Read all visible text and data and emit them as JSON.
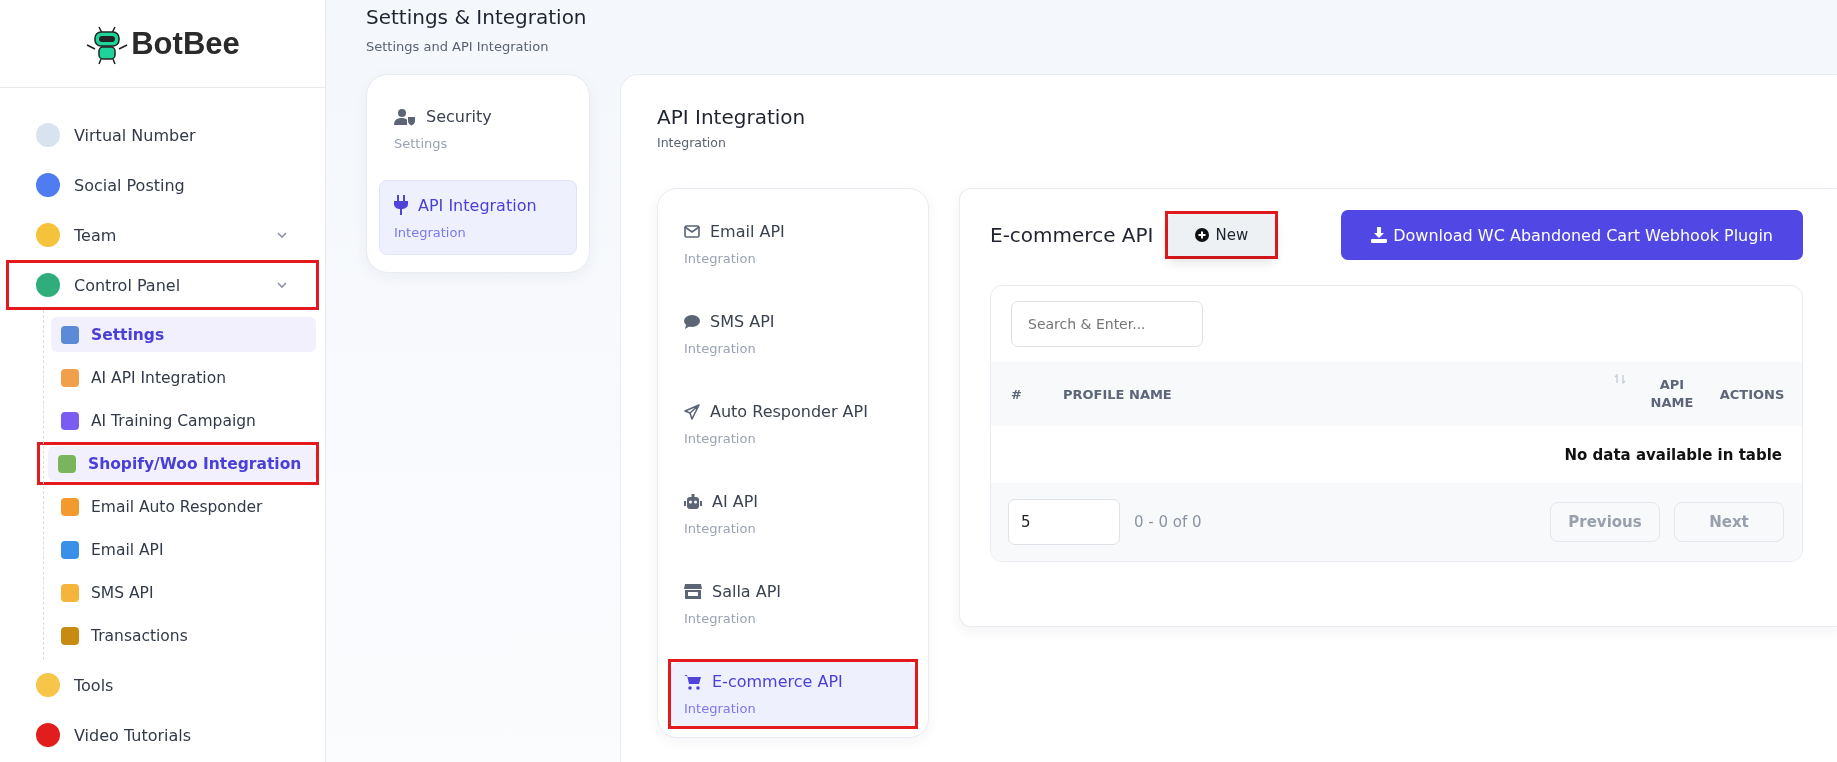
{
  "brand": {
    "name": "BotBee"
  },
  "sidebar": {
    "items": [
      {
        "label": "Virtual Number",
        "expandable": false,
        "highlighted": false
      },
      {
        "label": "Social Posting",
        "expandable": false,
        "highlighted": false
      },
      {
        "label": "Team",
        "expandable": true,
        "highlighted": false
      },
      {
        "label": "Control Panel",
        "expandable": true,
        "highlighted": true,
        "expanded": true,
        "children": [
          {
            "label": "Settings",
            "selected": true,
            "highlighted": false
          },
          {
            "label": "AI API Integration",
            "selected": false,
            "highlighted": false
          },
          {
            "label": "AI Training Campaign",
            "selected": false,
            "highlighted": false
          },
          {
            "label": "Shopify/Woo Integration",
            "selected": true,
            "highlighted": true
          },
          {
            "label": "Email Auto Responder",
            "selected": false,
            "highlighted": false
          },
          {
            "label": "Email API",
            "selected": false,
            "highlighted": false
          },
          {
            "label": "SMS API",
            "selected": false,
            "highlighted": false
          },
          {
            "label": "Transactions",
            "selected": false,
            "highlighted": false
          }
        ]
      },
      {
        "label": "Tools",
        "expandable": false,
        "highlighted": false
      },
      {
        "label": "Video Tutorials",
        "expandable": false,
        "highlighted": false
      }
    ]
  },
  "page": {
    "title": "Settings & Integration",
    "subtitle": "Settings and API Integration"
  },
  "settings_menu": [
    {
      "label": "Security",
      "sub": "Settings",
      "selected": false
    },
    {
      "label": "API Integration",
      "sub": "Integration",
      "selected": true
    }
  ],
  "api_panel": {
    "title": "API Integration",
    "subtitle": "Integration",
    "tabs": [
      {
        "label": "Email API",
        "sub": "Integration",
        "selected": false,
        "highlighted": false
      },
      {
        "label": "SMS API",
        "sub": "Integration",
        "selected": false,
        "highlighted": false
      },
      {
        "label": "Auto Responder API",
        "sub": "Integration",
        "selected": false,
        "highlighted": false
      },
      {
        "label": "AI API",
        "sub": "Integration",
        "selected": false,
        "highlighted": false
      },
      {
        "label": "Salla API",
        "sub": "Integration",
        "selected": false,
        "highlighted": false
      },
      {
        "label": "E-commerce API",
        "sub": "Integration",
        "selected": true,
        "highlighted": true
      }
    ]
  },
  "ecommerce": {
    "title": "E-commerce API",
    "new_button": {
      "label": "New",
      "highlighted": true
    },
    "download_button": "Download WC Abandoned Cart Webhook Plugin",
    "search": {
      "placeholder": "Search & Enter..."
    },
    "table": {
      "columns": [
        "#",
        "PROFILE NAME",
        "API NAME",
        "ACTIONS"
      ],
      "empty_message": "No data available in table"
    },
    "page_size": "5",
    "range": "0 - 0 of 0",
    "prev": {
      "label": "Previous",
      "disabled": true
    },
    "next": {
      "label": "Next",
      "disabled": true
    }
  }
}
